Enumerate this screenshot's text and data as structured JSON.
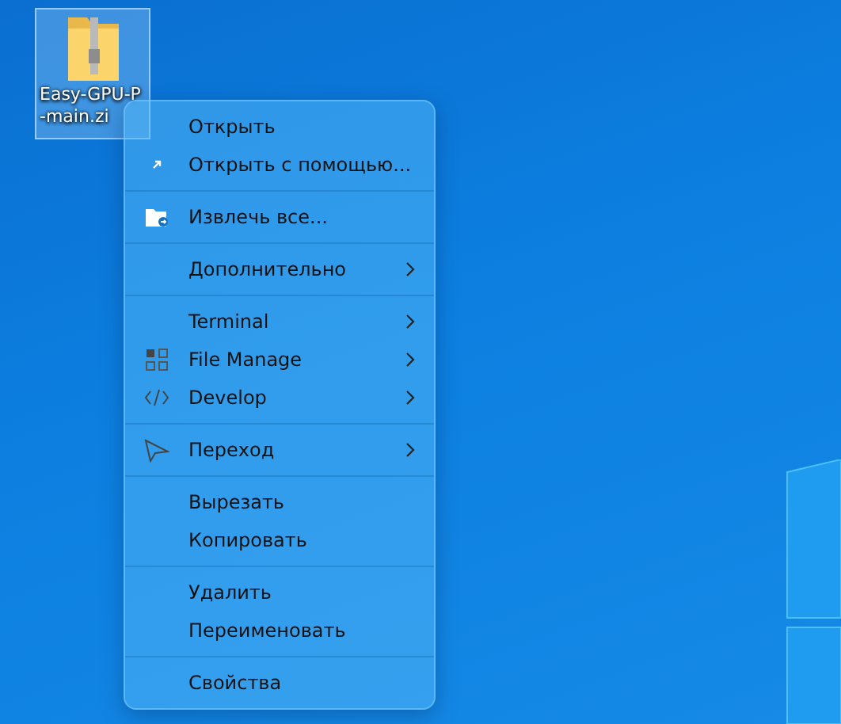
{
  "desktop_icon": {
    "label_lines": [
      "Easy-GPU-P",
      "-main.zi"
    ],
    "selected": true
  },
  "context_menu": {
    "groups": [
      {
        "items": [
          {
            "label": "Открыть",
            "kind": "plain",
            "has_submenu": false
          },
          {
            "label": "Открыть с помощью...",
            "kind": "shortcut",
            "has_submenu": false
          }
        ]
      },
      {
        "items": [
          {
            "label": "Извлечь все...",
            "kind": "extract",
            "has_submenu": false
          }
        ]
      },
      {
        "items": [
          {
            "label": "Дополнительно",
            "kind": "plain",
            "has_submenu": true
          }
        ]
      },
      {
        "items": [
          {
            "label": "Terminal",
            "kind": "plain",
            "has_submenu": true
          },
          {
            "label": "File Manage",
            "kind": "grid",
            "has_submenu": true
          },
          {
            "label": "Develop",
            "kind": "code",
            "has_submenu": true
          }
        ]
      },
      {
        "items": [
          {
            "label": "Переход",
            "kind": "pointer",
            "has_submenu": true
          }
        ]
      },
      {
        "items": [
          {
            "label": "Вырезать",
            "kind": "plain",
            "has_submenu": false
          },
          {
            "label": "Копировать",
            "kind": "plain",
            "has_submenu": false
          }
        ]
      },
      {
        "items": [
          {
            "label": "Удалить",
            "kind": "plain",
            "has_submenu": false
          },
          {
            "label": "Переименовать",
            "kind": "plain",
            "has_submenu": false
          }
        ]
      },
      {
        "items": [
          {
            "label": "Свойства",
            "kind": "plain",
            "has_submenu": false
          }
        ]
      }
    ]
  }
}
